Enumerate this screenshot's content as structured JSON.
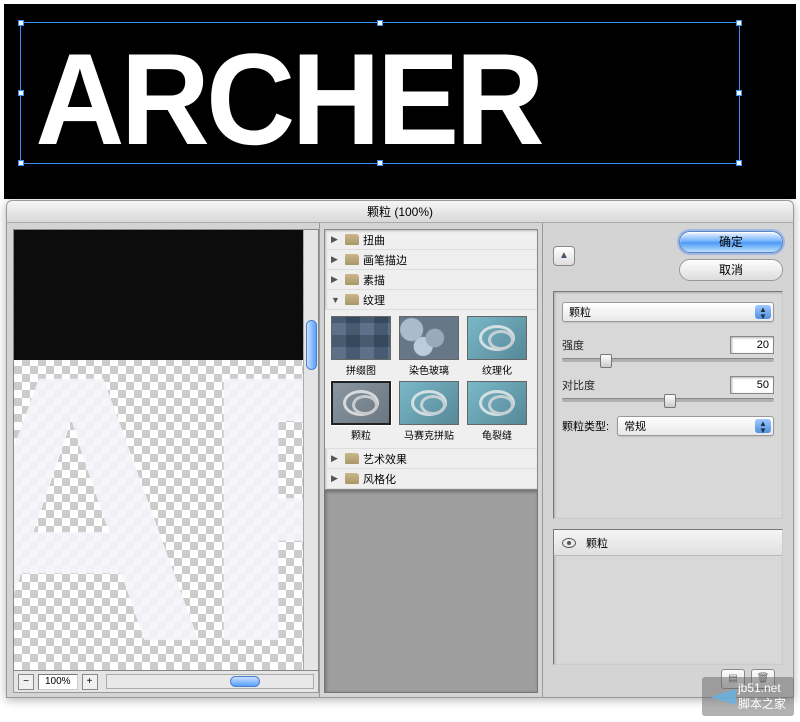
{
  "banner": {
    "text": "ARCHER"
  },
  "dialog": {
    "title": "颗粒 (100%)",
    "zoom": "100%",
    "categories": {
      "distort": "扭曲",
      "brush": "画笔描边",
      "sketch": "素描",
      "texture": "纹理",
      "artistic": "艺术效果",
      "stylize": "风格化"
    },
    "textures": {
      "patchwork": "拼缀图",
      "stained_glass": "染色玻璃",
      "texturizer": "纹理化",
      "grain": "颗粒",
      "mosaic": "马赛克拼贴",
      "craquelure": "龟裂缝"
    },
    "buttons": {
      "ok": "确定",
      "cancel": "取消",
      "zoom_out": "−",
      "zoom_in": "+",
      "collapse": "▲"
    },
    "options": {
      "filter_name": "颗粒",
      "intensity_label": "强度",
      "intensity_value": "20",
      "contrast_label": "对比度",
      "contrast_value": "50",
      "type_label": "颗粒类型:",
      "type_value": "常规"
    },
    "layers": {
      "item": "颗粒"
    }
  },
  "watermark": {
    "site": "jb51.net",
    "name": "脚本之家"
  }
}
